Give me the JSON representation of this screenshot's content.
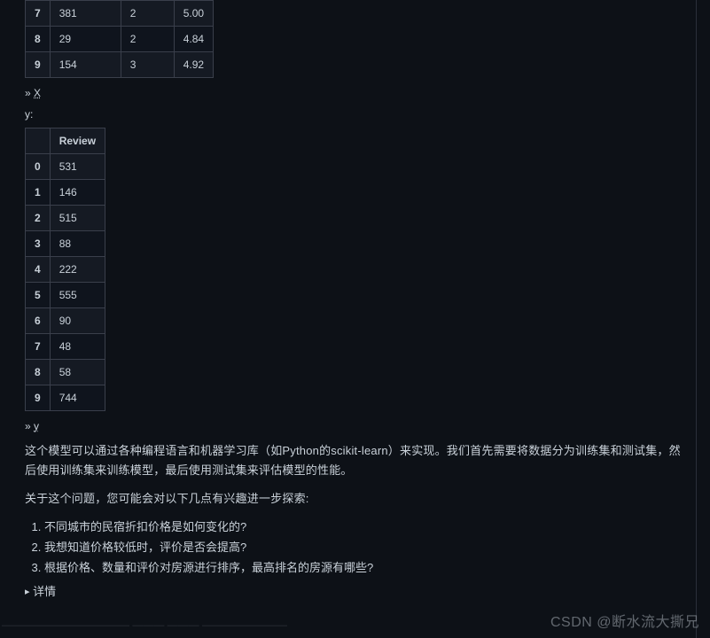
{
  "table_top": {
    "rows": [
      {
        "idx": "7",
        "c1": "381",
        "c2": "2",
        "c3": "5.00"
      },
      {
        "idx": "8",
        "c1": "29",
        "c2": "2",
        "c3": "4.84"
      },
      {
        "idx": "9",
        "c1": "154",
        "c2": "3",
        "c3": "4.92"
      }
    ]
  },
  "link_x_prefix": "» ",
  "link_x": "X",
  "y_label": "y:",
  "table_y": {
    "header": "Review",
    "rows": [
      {
        "idx": "0",
        "val": "531"
      },
      {
        "idx": "1",
        "val": "146"
      },
      {
        "idx": "2",
        "val": "515"
      },
      {
        "idx": "3",
        "val": "88"
      },
      {
        "idx": "4",
        "val": "222"
      },
      {
        "idx": "5",
        "val": "555"
      },
      {
        "idx": "6",
        "val": "90"
      },
      {
        "idx": "7",
        "val": "48"
      },
      {
        "idx": "8",
        "val": "58"
      },
      {
        "idx": "9",
        "val": "744"
      }
    ]
  },
  "link_y_prefix": "» ",
  "link_y": "y",
  "para1": "这个模型可以通过各种编程语言和机器学习库（如Python的scikit-learn）来实现。我们首先需要将数据分为训练集和测试集，然后使用训练集来训练模型，最后使用测试集来评估模型的性能。",
  "para2": "关于这个问题，您可能会对以下几点有兴趣进一步探索:",
  "list": [
    "不同城市的民宿折扣价格是如何变化的?",
    "我想知道价格较低时，评价是否会提高?",
    "根据价格、数量和评价对房源进行排序，最高排名的房源有哪些?"
  ],
  "details_label": "详情",
  "watermark_left": "———————————— ——— ——— ————————",
  "watermark_right": "CSDN @断水流大撕兄"
}
